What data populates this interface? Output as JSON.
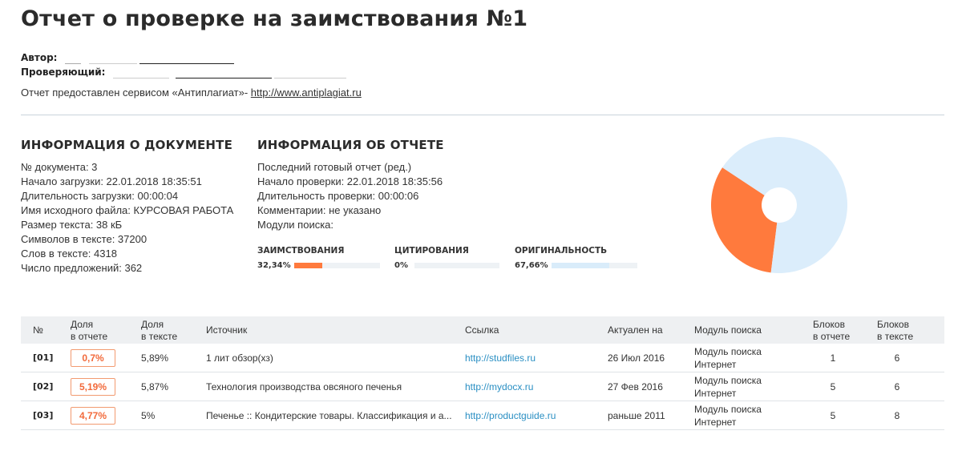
{
  "title": "Отчет о проверке на заимствования №1",
  "meta": {
    "author_label": "Автор:",
    "reviewer_label": "Проверяющий:",
    "service_text": "Отчет предоставлен сервисом «Антиплагиат»-",
    "service_link": "http://www.antiplagiat.ru"
  },
  "doc_info": {
    "title": "ИНФОРМАЦИЯ О ДОКУМЕНТЕ",
    "lines": [
      "№ документа: 3",
      "Начало загрузки: 22.01.2018 18:35:51",
      "Длительность загрузки: 00:00:04",
      "Имя исходного файла: КУРСОВАЯ РАБОТА",
      "Размер текста: 38 кБ",
      "Символов в тексте: 37200",
      "Слов в тексте: 4318",
      "Число предложений: 362"
    ]
  },
  "report_info": {
    "title": "ИНФОРМАЦИЯ ОБ ОТЧЕТЕ",
    "lines": [
      "Последний готовый отчет (ред.)",
      "Начало проверки: 22.01.2018 18:35:56",
      "Длительность проверки: 00:00:06",
      "Комментарии: не указано",
      "Модули поиска:"
    ]
  },
  "metrics": [
    {
      "label": "ЗАИМСТВОВАНИЯ",
      "value_text": "32,34%",
      "fraction": 0.3234,
      "color": "#ff7a3d"
    },
    {
      "label": "ЦИТИРОВАНИЯ",
      "value_text": "0%",
      "fraction": 0.0,
      "color": "#7fc56a"
    },
    {
      "label": "ОРИГИНАЛЬНОСТЬ",
      "value_text": "67,66%",
      "fraction": 0.6766,
      "color": "#d9ecfa"
    }
  ],
  "chart_data": {
    "type": "pie",
    "categories": [
      "Заимствования",
      "Цитирования",
      "Оригинальность"
    ],
    "values": [
      32.34,
      0,
      67.66
    ],
    "colors": [
      "#ff7a3d",
      "#7fc56a",
      "#dbedfb"
    ],
    "donut": true
  },
  "table": {
    "headers": [
      {
        "line1": "№",
        "line2": ""
      },
      {
        "line1": "Доля",
        "line2": "в отчете"
      },
      {
        "line1": "Доля",
        "line2": "в тексте"
      },
      {
        "line1": "Источник",
        "line2": ""
      },
      {
        "line1": "Ссылка",
        "line2": ""
      },
      {
        "line1": "Актуален на",
        "line2": ""
      },
      {
        "line1": "Модуль поиска",
        "line2": ""
      },
      {
        "line1": "Блоков",
        "line2": "в отчете"
      },
      {
        "line1": "Блоков",
        "line2": "в тексте"
      }
    ],
    "rows": [
      {
        "num": "[01]",
        "share_report": "0,7%",
        "share_text": "5,89%",
        "source": "1 лит обзор(хз)",
        "link": "http://studfiles.ru",
        "actual": "26 Июл 2016",
        "module1": "Модуль поиска",
        "module2": "Интернет",
        "blocks_report": "1",
        "blocks_text": "6"
      },
      {
        "num": "[02]",
        "share_report": "5,19%",
        "share_text": "5,87%",
        "source": "Технология производства овсяного печенья",
        "link": "http://mydocx.ru",
        "actual": "27 Фев 2016",
        "module1": "Модуль поиска",
        "module2": "Интернет",
        "blocks_report": "5",
        "blocks_text": "6"
      },
      {
        "num": "[03]",
        "share_report": "4,77%",
        "share_text": "5%",
        "source": "Печенье :: Кондитерские товары. Классификация и а...",
        "link": "http://productguide.ru",
        "actual": "раньше 2011",
        "module1": "Модуль поиска",
        "module2": "Интернет",
        "blocks_report": "5",
        "blocks_text": "8"
      }
    ]
  }
}
